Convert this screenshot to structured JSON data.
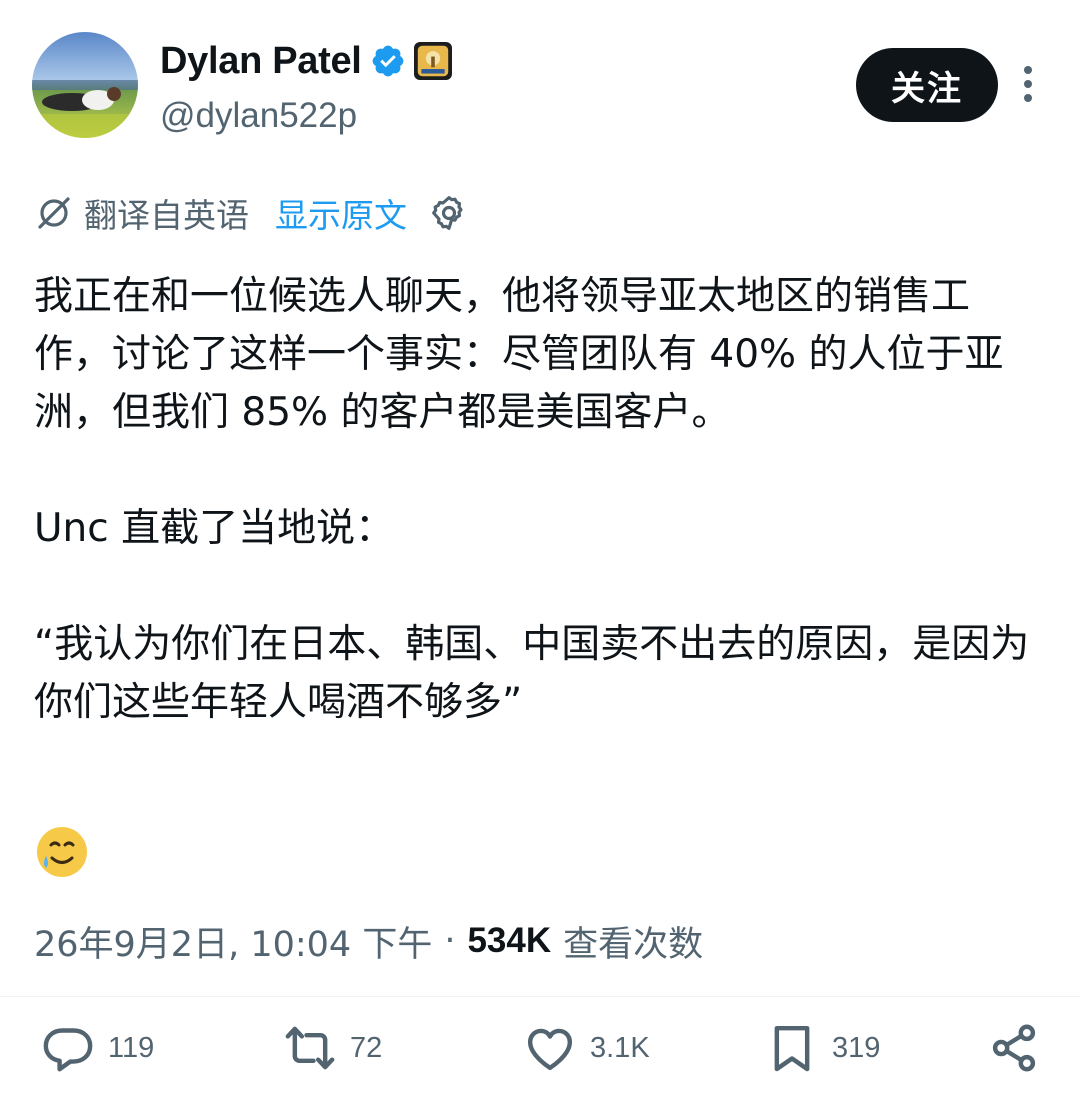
{
  "header": {
    "display_name": "Dylan Patel",
    "handle": "@dylan522p",
    "follow_label": "关注",
    "verified_icon": "verified-badge-icon",
    "affiliation_icon": "affiliation-badge-icon"
  },
  "translation": {
    "label": "翻译自英语",
    "show_original": "显示原文"
  },
  "tweet": {
    "paragraph1": "我正在和一位候选人聊天，他将领导亚太地区的销售工作，讨论了这样一个事实：尽管团队有 40% 的人位于亚洲，但我们 85% 的客户都是美国客户。",
    "paragraph2": "Unc 直截了当地说：",
    "paragraph3": "“我认为你们在日本、韩国、中国卖不出去的原因，是因为你们这些年轻人喝酒不够多”",
    "emoji": "🥲"
  },
  "meta": {
    "timestamp": "26年9月2日, 10:04 下午",
    "separator": "·",
    "views_count": "534K",
    "views_label": "查看次数"
  },
  "actions": {
    "reply_count": "119",
    "repost_count": "72",
    "like_count": "3.1K",
    "bookmark_count": "319"
  },
  "colors": {
    "text_primary": "#0f1419",
    "text_secondary": "#536471",
    "accent": "#1d9bf0",
    "verified": "#1d9bf0"
  }
}
